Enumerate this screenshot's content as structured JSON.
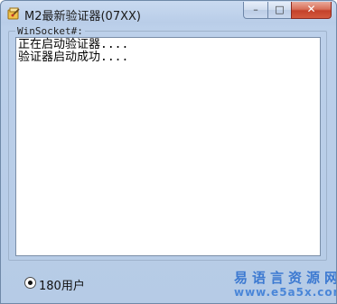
{
  "window": {
    "title": "M2最新验证器(07XX)",
    "controls": {
      "minimize_icon": "minimize-icon",
      "maximize_icon": "maximize-icon",
      "close_icon": "close-icon",
      "minimize_glyph": "–",
      "maximize_glyph": "□",
      "close_glyph": "✕"
    }
  },
  "group": {
    "label": "WinSocket#:"
  },
  "log": {
    "lines": [
      "正在启动验证器....",
      "验证器启动成功...."
    ]
  },
  "option": {
    "label": "180用户",
    "checked": true
  },
  "watermark": {
    "text_cn": "易语言资源网",
    "url": "www.e5a5x.com"
  },
  "colors": {
    "window_bg": "#bcd0ea",
    "close_button": "#c4412a",
    "watermark": "#3d7ad1"
  }
}
